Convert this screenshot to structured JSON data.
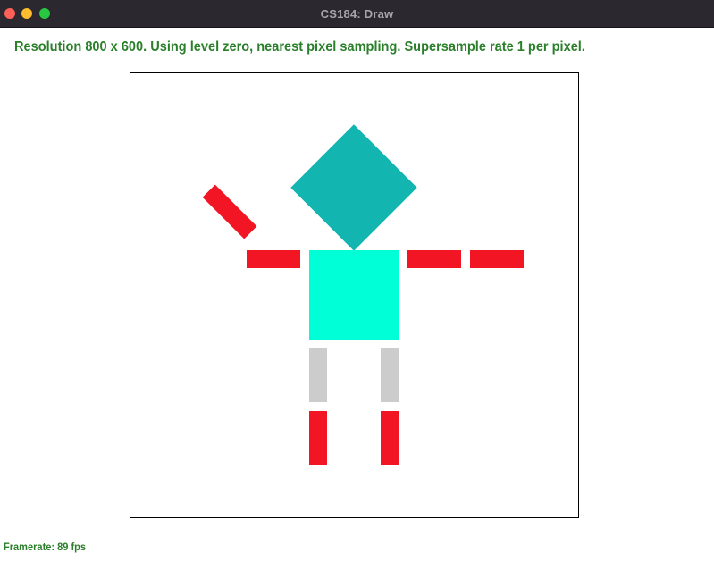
{
  "window": {
    "title": "CS184: Draw",
    "controls": {
      "close_icon": "close-icon",
      "minimize_icon": "minimize-icon",
      "maximize_icon": "maximize-icon"
    }
  },
  "status": {
    "text": "Resolution 800 x 600. Using level zero, nearest pixel sampling. Supersample rate 1 per pixel."
  },
  "footer": {
    "framerate": "Framerate: 89 fps"
  },
  "colors": {
    "titlebar": "#2b2830",
    "status_text": "#2a7f2a",
    "head": "#12b5b0",
    "body": "#00ffd7",
    "limb_red": "#f21524",
    "leg_grey": "#cccccc",
    "canvas_border": "#000000"
  }
}
